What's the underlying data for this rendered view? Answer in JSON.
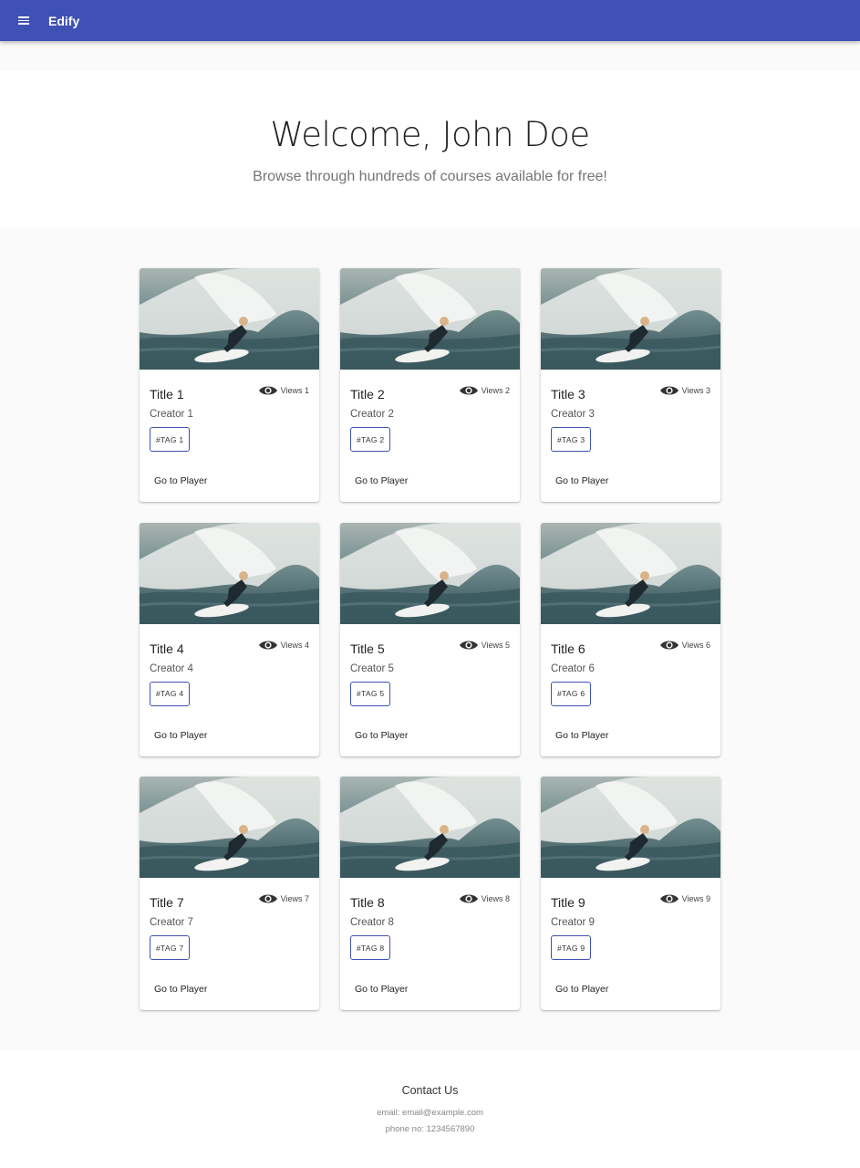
{
  "appbar": {
    "brand": "Edify",
    "menu_icon": "menu-icon"
  },
  "hero": {
    "title": "Welcome, John Doe",
    "subtitle": "Browse through hundreds of courses available for free!"
  },
  "courses": [
    {
      "title": "Title 1",
      "creator": "Creator 1",
      "views": "Views 1",
      "tag": "#TAG 1",
      "action": "Go to Player"
    },
    {
      "title": "Title 2",
      "creator": "Creator 2",
      "views": "Views 2",
      "tag": "#TAG 2",
      "action": "Go to Player"
    },
    {
      "title": "Title 3",
      "creator": "Creator 3",
      "views": "Views 3",
      "tag": "#TAG 3",
      "action": "Go to Player"
    },
    {
      "title": "Title 4",
      "creator": "Creator 4",
      "views": "Views 4",
      "tag": "#TAG 4",
      "action": "Go to Player"
    },
    {
      "title": "Title 5",
      "creator": "Creator 5",
      "views": "Views 5",
      "tag": "#TAG 5",
      "action": "Go to Player"
    },
    {
      "title": "Title 6",
      "creator": "Creator 6",
      "views": "Views 6",
      "tag": "#TAG 6",
      "action": "Go to Player"
    },
    {
      "title": "Title 7",
      "creator": "Creator 7",
      "views": "Views 7",
      "tag": "#TAG 7",
      "action": "Go to Player"
    },
    {
      "title": "Title 8",
      "creator": "Creator 8",
      "views": "Views 8",
      "tag": "#TAG 8",
      "action": "Go to Player"
    },
    {
      "title": "Title 9",
      "creator": "Creator 9",
      "views": "Views 9",
      "tag": "#TAG 9",
      "action": "Go to Player"
    }
  ],
  "footer": {
    "title": "Contact Us",
    "email": "email: email@example.com",
    "phone": "phone no: 1234567890"
  },
  "colors": {
    "primary": "#3f51b5",
    "background": "#fafafa"
  }
}
